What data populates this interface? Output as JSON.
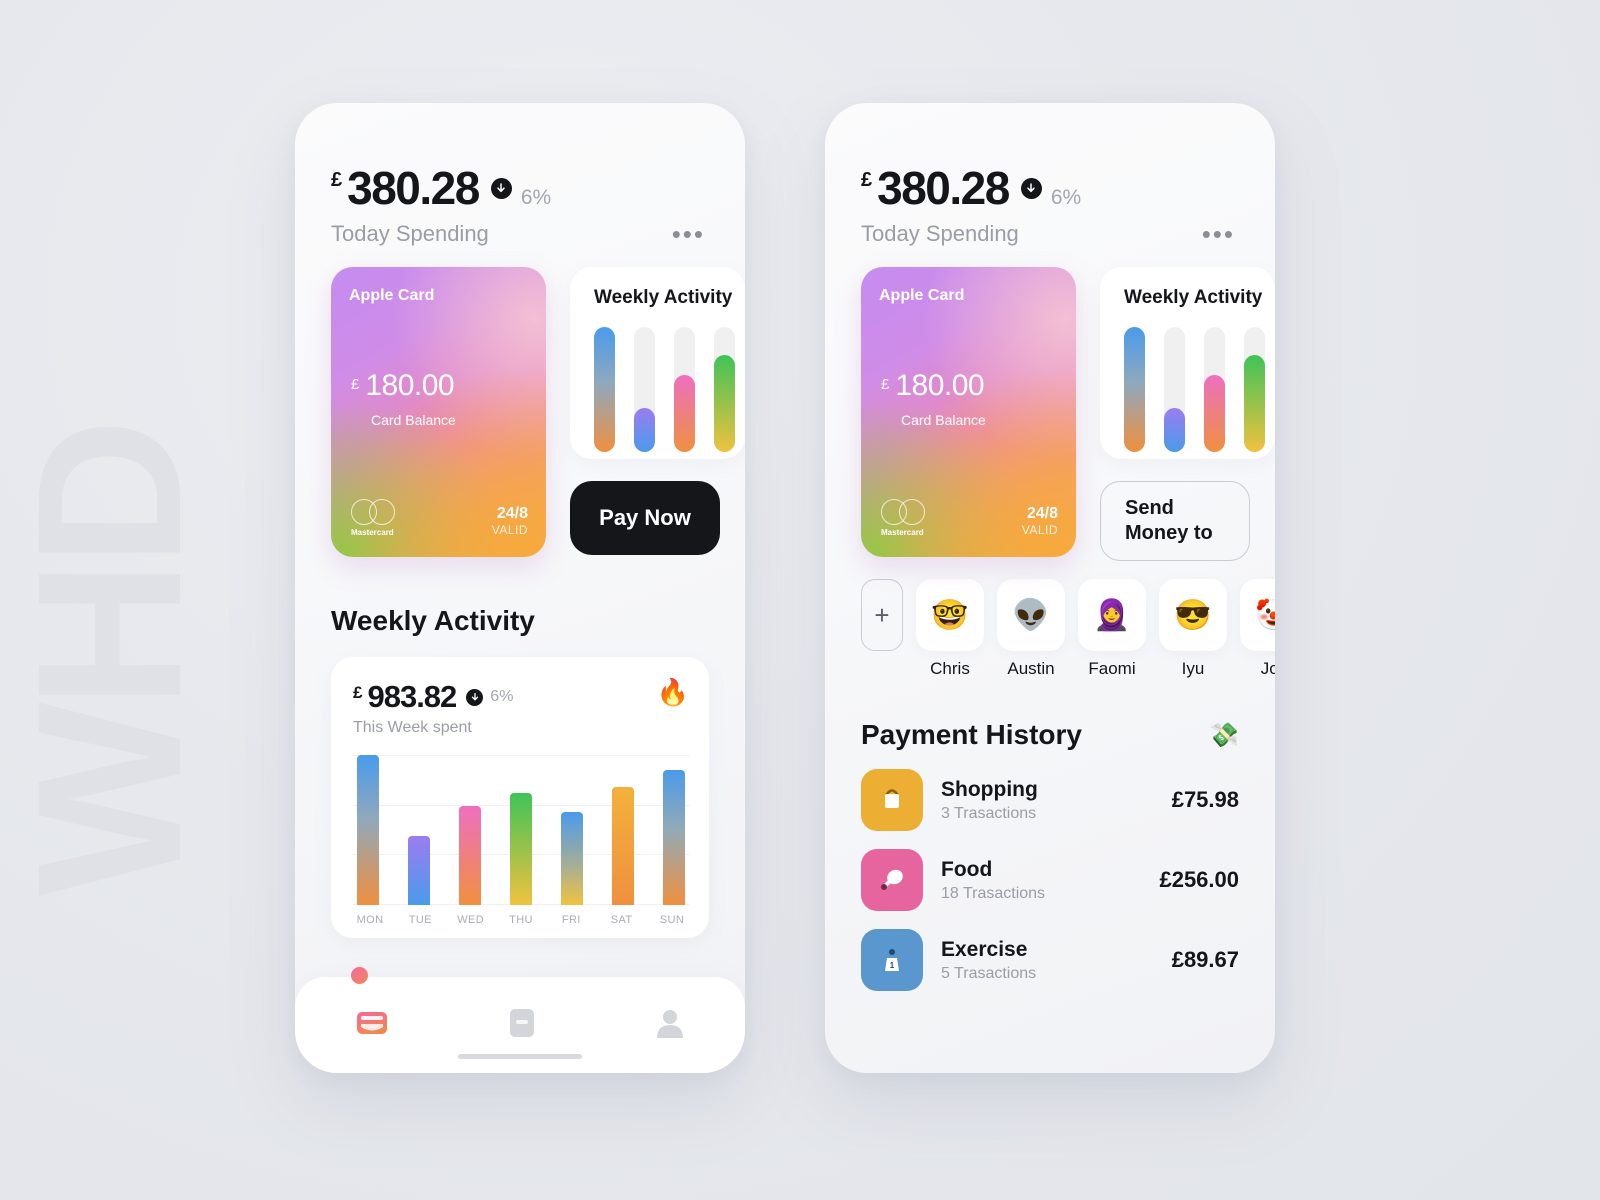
{
  "watermark": "WHD",
  "left_phone": {
    "header": {
      "currency": "£",
      "amount": "380.28",
      "percent": "6%",
      "label": "Today Spending",
      "menu": "•••"
    },
    "card": {
      "title": "Apple Card",
      "currency": "£",
      "balance": "180.00",
      "balance_label": "Card Balance",
      "network": "Mastercard",
      "valid_value": "24/8",
      "valid_label": "VALID"
    },
    "mini_widget": {
      "title": "Weekly Activity"
    },
    "pay_button": "Pay Now",
    "section_title": "Weekly Activity",
    "chart_header": {
      "currency": "£",
      "amount": "983.82",
      "percent": "6%",
      "label": "This Week spent",
      "badge_icon": "fire-emoji",
      "badge_glyph": "🔥"
    },
    "tabs": [
      {
        "name": "wallet",
        "active": true
      },
      {
        "name": "cards",
        "active": false
      },
      {
        "name": "profile",
        "active": false
      }
    ]
  },
  "right_phone": {
    "header": {
      "currency": "£",
      "amount": "380.28",
      "percent": "6%",
      "label": "Today Spending",
      "menu": "•••"
    },
    "card": {
      "title": "Apple Card",
      "currency": "£",
      "balance": "180.00",
      "balance_label": "Card Balance",
      "network": "Mastercard",
      "valid_value": "24/8",
      "valid_label": "VALID"
    },
    "mini_widget": {
      "title": "Weekly Activity"
    },
    "send_button": {
      "line1": "Send",
      "line2": "Money to"
    },
    "add_contact_label": "+",
    "contacts": [
      {
        "name": "Chris",
        "emoji": "🤓"
      },
      {
        "name": "Austin",
        "emoji": "👽"
      },
      {
        "name": "Faomi",
        "emoji": "🧕"
      },
      {
        "name": "Iyu",
        "emoji": "😎"
      },
      {
        "name": "Jok",
        "emoji": "🤡"
      }
    ],
    "payment_history": {
      "title": "Payment History",
      "icon_glyph": "💸",
      "rows": [
        {
          "icon": "shopping-bag-icon",
          "glyph": "👜",
          "color": "#edae34",
          "name": "Shopping",
          "count": "3 Trasactions",
          "amount": "£75.98"
        },
        {
          "icon": "food-icon",
          "glyph": "🍗",
          "color": "#e7659f",
          "name": "Food",
          "count": "18 Trasactions",
          "amount": "£256.00"
        },
        {
          "icon": "weight-icon",
          "glyph": "🏋",
          "color": "#5a97ce",
          "name": "Exercise",
          "count": "5 Trasactions",
          "amount": "£89.67"
        }
      ]
    }
  },
  "chart_data": {
    "type": "bar",
    "title": "Weekly Activity",
    "subtitle": "This Week spent",
    "total": 983.82,
    "currency": "£",
    "change_percent": -6,
    "categories": [
      "MON",
      "TUE",
      "WED",
      "THU",
      "FRI",
      "SAT",
      "SUN"
    ],
    "values": [
      100,
      46,
      66,
      75,
      62,
      79,
      90
    ],
    "ylim": [
      0,
      100
    ],
    "xlabel": "",
    "ylabel": "",
    "grid": true,
    "gridlines": 4,
    "legend": "none",
    "bar_gradients": [
      {
        "day": "MON",
        "top": "#4a9bea",
        "bottom": "#f0903f"
      },
      {
        "day": "TUE",
        "top": "#9b7cf0",
        "bottom": "#4a9bea"
      },
      {
        "day": "WED",
        "top": "#ee6fc0",
        "bottom": "#f0903f"
      },
      {
        "day": "THU",
        "top": "#3fc357",
        "bottom": "#f0c23f"
      },
      {
        "day": "FRI",
        "top": "#4a9bea",
        "bottom": "#f0c23f"
      },
      {
        "day": "SAT",
        "top": "#f2b13b",
        "bottom": "#f0903f"
      },
      {
        "day": "SUN",
        "top": "#4a9bea",
        "bottom": "#f0903f"
      }
    ],
    "mini_chart": {
      "type": "bar",
      "values": [
        100,
        35,
        62,
        78
      ],
      "track_color": "#f0f0f1",
      "bar_gradients": [
        {
          "top": "#4a9bea",
          "bottom": "#f0903f"
        },
        {
          "top": "#9b7cf0",
          "bottom": "#4a9bea"
        },
        {
          "top": "#ee6fc0",
          "bottom": "#f0903f"
        },
        {
          "top": "#3fc357",
          "bottom": "#f0c23f"
        }
      ]
    }
  },
  "colors": {
    "background": "#e8eaee",
    "text_primary": "#15161a",
    "text_muted": "#9a9da6",
    "accent_dark": "#15161a",
    "card_purple": "#c58cf0",
    "card_pink": "#ea89b7",
    "card_orange": "#f3b04d",
    "card_green": "#8dc94a"
  }
}
